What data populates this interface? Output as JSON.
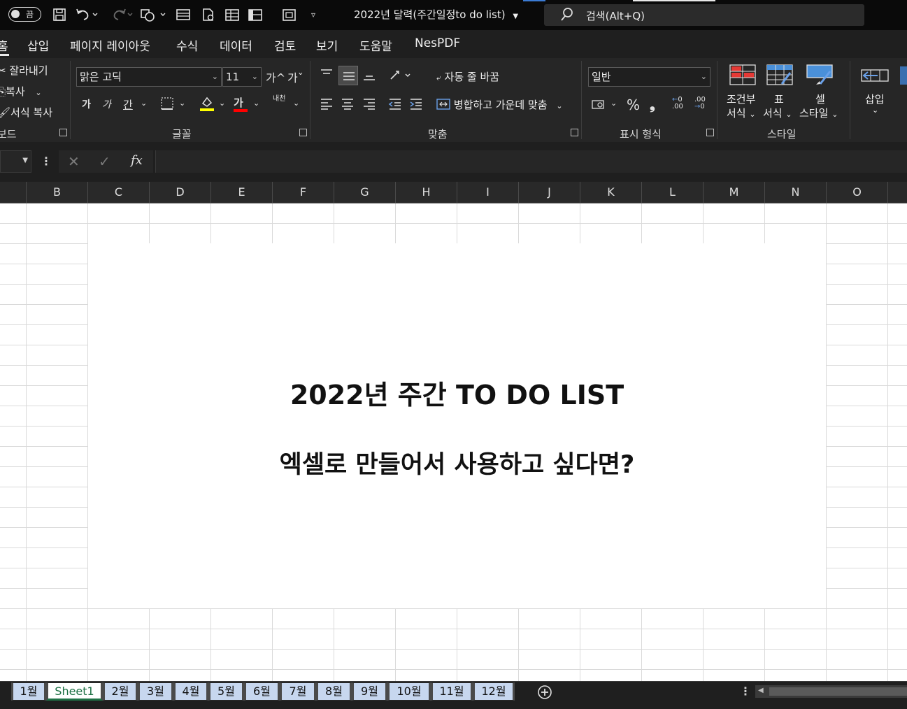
{
  "titlebar": {
    "autosave_label": "끔",
    "doc_title": "2022년 달력(주간일정to do list)",
    "search_label": "검색(Alt+Q)"
  },
  "ribbon_tabs": [
    "홈",
    "삽입",
    "페이지 레이아웃",
    "수식",
    "데이터",
    "검토",
    "보기",
    "도움말",
    "NesPDF"
  ],
  "clipboard": {
    "cut": "잘라내기",
    "copy": "복사",
    "format_painter": "서식 복사",
    "group_label": "보드"
  },
  "font": {
    "family": "맑은 고딕",
    "size": "11",
    "bold": "가",
    "italic": "가",
    "underline": "간",
    "grow": "가^",
    "shrink": "가ˇ",
    "font_color_glyph": "가",
    "phonetic": "내천",
    "group_label": "글꼴",
    "fill_color": "#ffff00",
    "text_color": "#ff0000"
  },
  "alignment": {
    "wrap_text": "자동 줄 바꿈",
    "merge_center": "병합하고 가운데 맞춤",
    "group_label": "맞춤"
  },
  "number": {
    "format": "일반",
    "percent": "%",
    "comma": "❟",
    "inc_decimal": ".00",
    "dec_decimal": ".00",
    "group_label": "표시 형식"
  },
  "styles": {
    "conditional_line1": "조건부",
    "conditional_line2": "서식",
    "table_line1": "표",
    "table_line2": "서식",
    "cell_line1": "셀",
    "cell_line2": "스타일",
    "group_label": "스타일"
  },
  "cells": {
    "insert": "삽입"
  },
  "formula_bar": {
    "fx": "fx"
  },
  "columns": [
    "B",
    "C",
    "D",
    "E",
    "F",
    "G",
    "H",
    "I",
    "J",
    "K",
    "L",
    "M",
    "N",
    "O"
  ],
  "sheet": {
    "headline1": "2022년 주간 TO DO LIST",
    "headline2": "엑셀로 만들어서 사용하고 싶다면?"
  },
  "sheet_tabs": [
    "1월",
    "Sheet1",
    "2월",
    "3월",
    "4월",
    "5월",
    "6월",
    "7월",
    "8월",
    "9월",
    "10월",
    "11월",
    "12월"
  ],
  "active_sheet": "Sheet1",
  "accent_color": "#1e7145"
}
